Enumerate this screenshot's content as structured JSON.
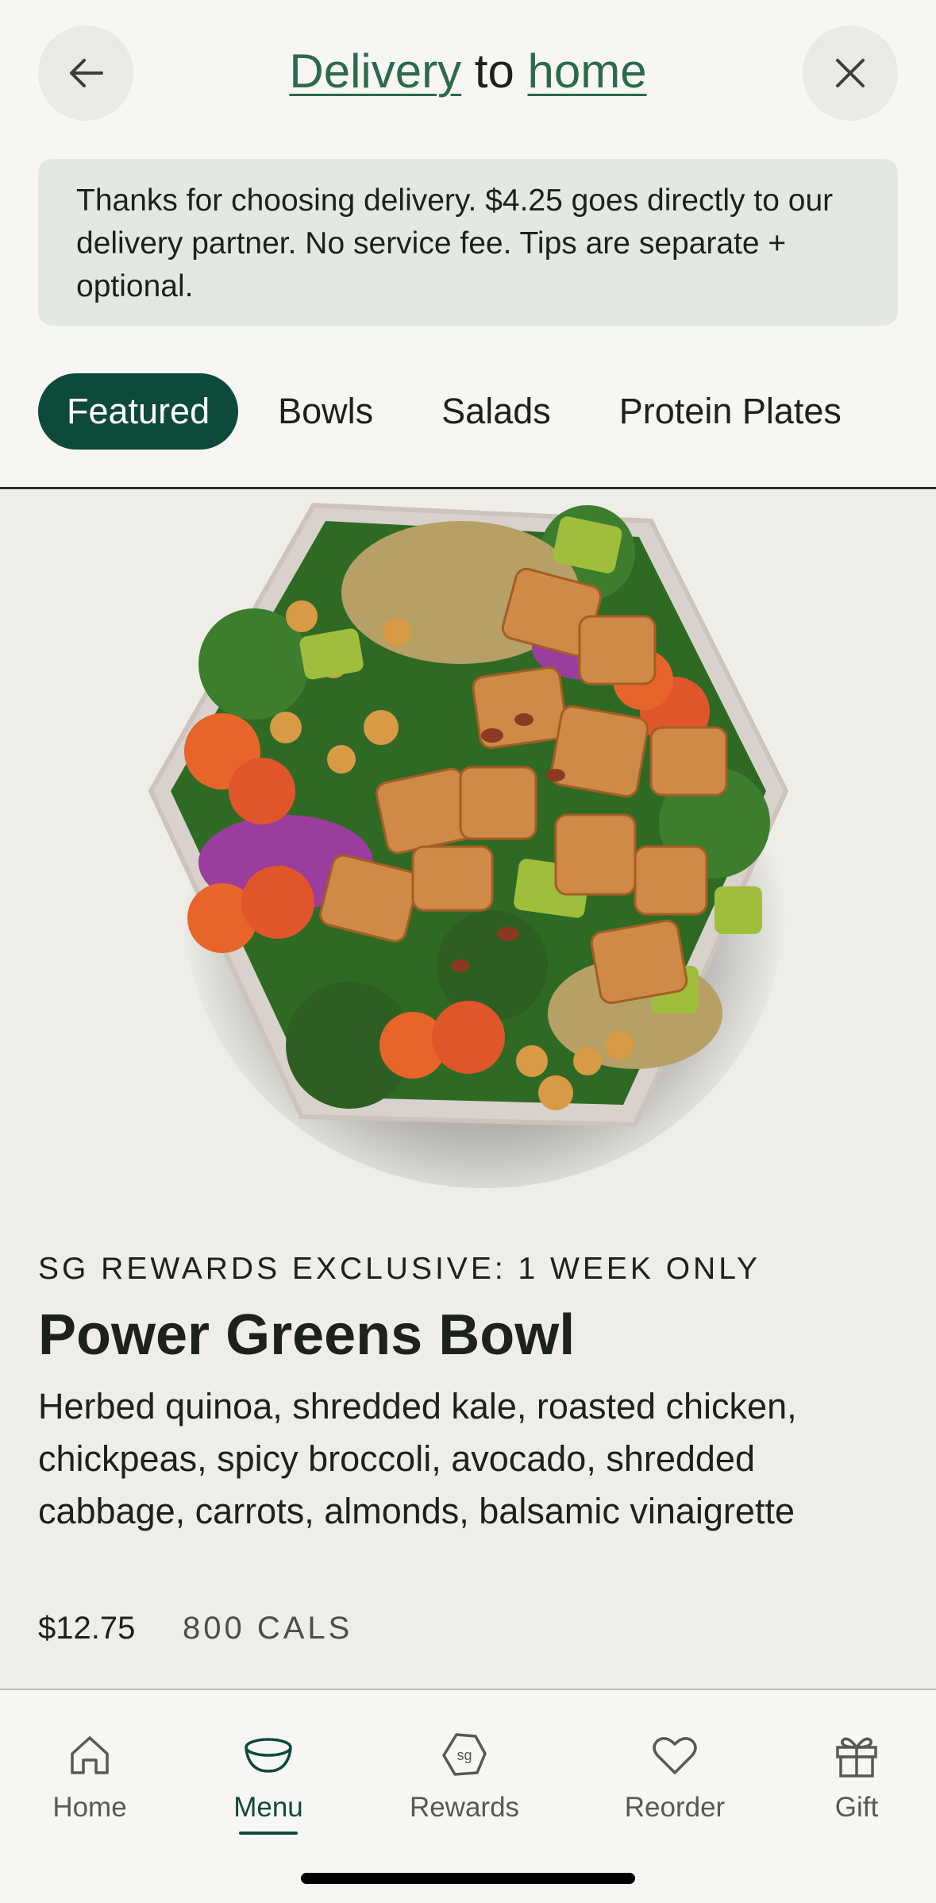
{
  "header": {
    "title_link_1": "Delivery",
    "title_middle": " to ",
    "title_link_2": "home",
    "back_icon": "arrow-left-icon",
    "close_icon": "close-icon"
  },
  "notice": {
    "text": "Thanks for choosing delivery. $4.25 goes directly to our delivery partner. No service fee. Tips are separate + optional."
  },
  "tabs": [
    {
      "label": "Featured",
      "active": true
    },
    {
      "label": "Bowls",
      "active": false
    },
    {
      "label": "Salads",
      "active": false
    },
    {
      "label": "Protein Plates",
      "active": false
    }
  ],
  "product": {
    "eyebrow": "SG REWARDS EXCLUSIVE: 1 WEEK ONLY",
    "name": "Power Greens Bowl",
    "description": "Herbed quinoa, shredded kale, roasted chicken, chickpeas, spicy broccoli, avocado, shredded cabbage, carrots, almonds, balsamic vinaigrette",
    "price": "$12.75",
    "calories": "800 CALS"
  },
  "bottom_nav": [
    {
      "label": "Home",
      "icon": "home-icon",
      "active": false
    },
    {
      "label": "Menu",
      "icon": "bowl-icon",
      "active": true
    },
    {
      "label": "Rewards",
      "icon": "sg-badge-icon",
      "active": false
    },
    {
      "label": "Reorder",
      "icon": "heart-icon",
      "active": false
    },
    {
      "label": "Gift",
      "icon": "gift-icon",
      "active": false
    }
  ],
  "colors": {
    "accent": "#0e4a3c",
    "link": "#2b6a4a",
    "notice_bg": "#e3e8e2"
  }
}
